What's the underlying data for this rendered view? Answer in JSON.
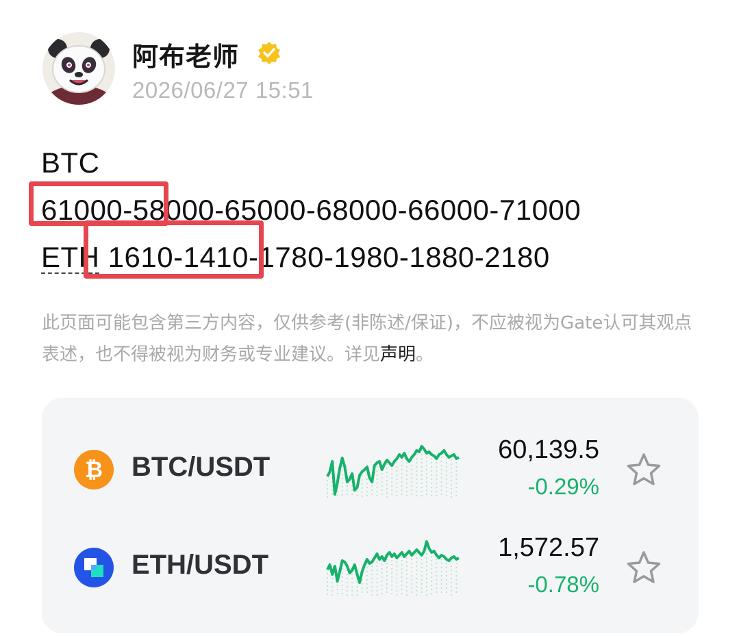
{
  "author": {
    "name": "阿布老师",
    "post_time": "2026/06/27 15:51"
  },
  "post": {
    "line1": "BTC",
    "line2": "61000-58000-65000-68000-66000-71000",
    "line3_label": "ETH",
    "line3_values": " 1610-1410-1780-1980-1880-2180"
  },
  "disclaimer": {
    "text": "此页面可能包含第三方内容，仅供参考(非陈述/保证)，不应被视为Gate认可其观点表述，也不得被视为财务或专业建议。详见",
    "link": "声明",
    "end": "。"
  },
  "tickers": [
    {
      "pair": "BTC/USDT",
      "price": "60,139.5",
      "change": "-0.29%",
      "icon": "bitcoin-icon",
      "icon_color": "#f7931a",
      "spark": [
        62,
        55,
        40,
        88,
        72,
        50,
        35,
        48,
        70,
        66,
        58,
        82,
        78,
        60,
        55,
        52,
        48,
        64,
        70,
        46,
        42,
        40,
        52,
        44,
        38,
        42,
        46,
        40,
        36,
        30,
        34,
        28,
        36,
        40,
        34,
        30,
        24,
        26,
        18,
        22,
        28,
        26,
        30,
        32,
        36,
        30,
        28,
        24,
        30,
        34,
        32,
        30,
        36,
        34
      ]
    },
    {
      "pair": "ETH/USDT",
      "price": "1,572.57",
      "change": "-0.78%",
      "icon": "eth-square-icon",
      "icon_color": "#2354e6",
      "spark": [
        55,
        48,
        62,
        50,
        72,
        58,
        42,
        44,
        50,
        60,
        56,
        48,
        62,
        74,
        58,
        48,
        40,
        46,
        44,
        38,
        32,
        40,
        36,
        42,
        34,
        30,
        36,
        32,
        38,
        34,
        30,
        36,
        32,
        28,
        34,
        30,
        26,
        30,
        34,
        28,
        14,
        24,
        30,
        28,
        34,
        38,
        34,
        36,
        40,
        42,
        38,
        36,
        40,
        38
      ]
    }
  ],
  "colors": {
    "accent_green": "#17b26a",
    "highlight_red": "#e5464f",
    "verified_gold": "#f5c31b"
  }
}
